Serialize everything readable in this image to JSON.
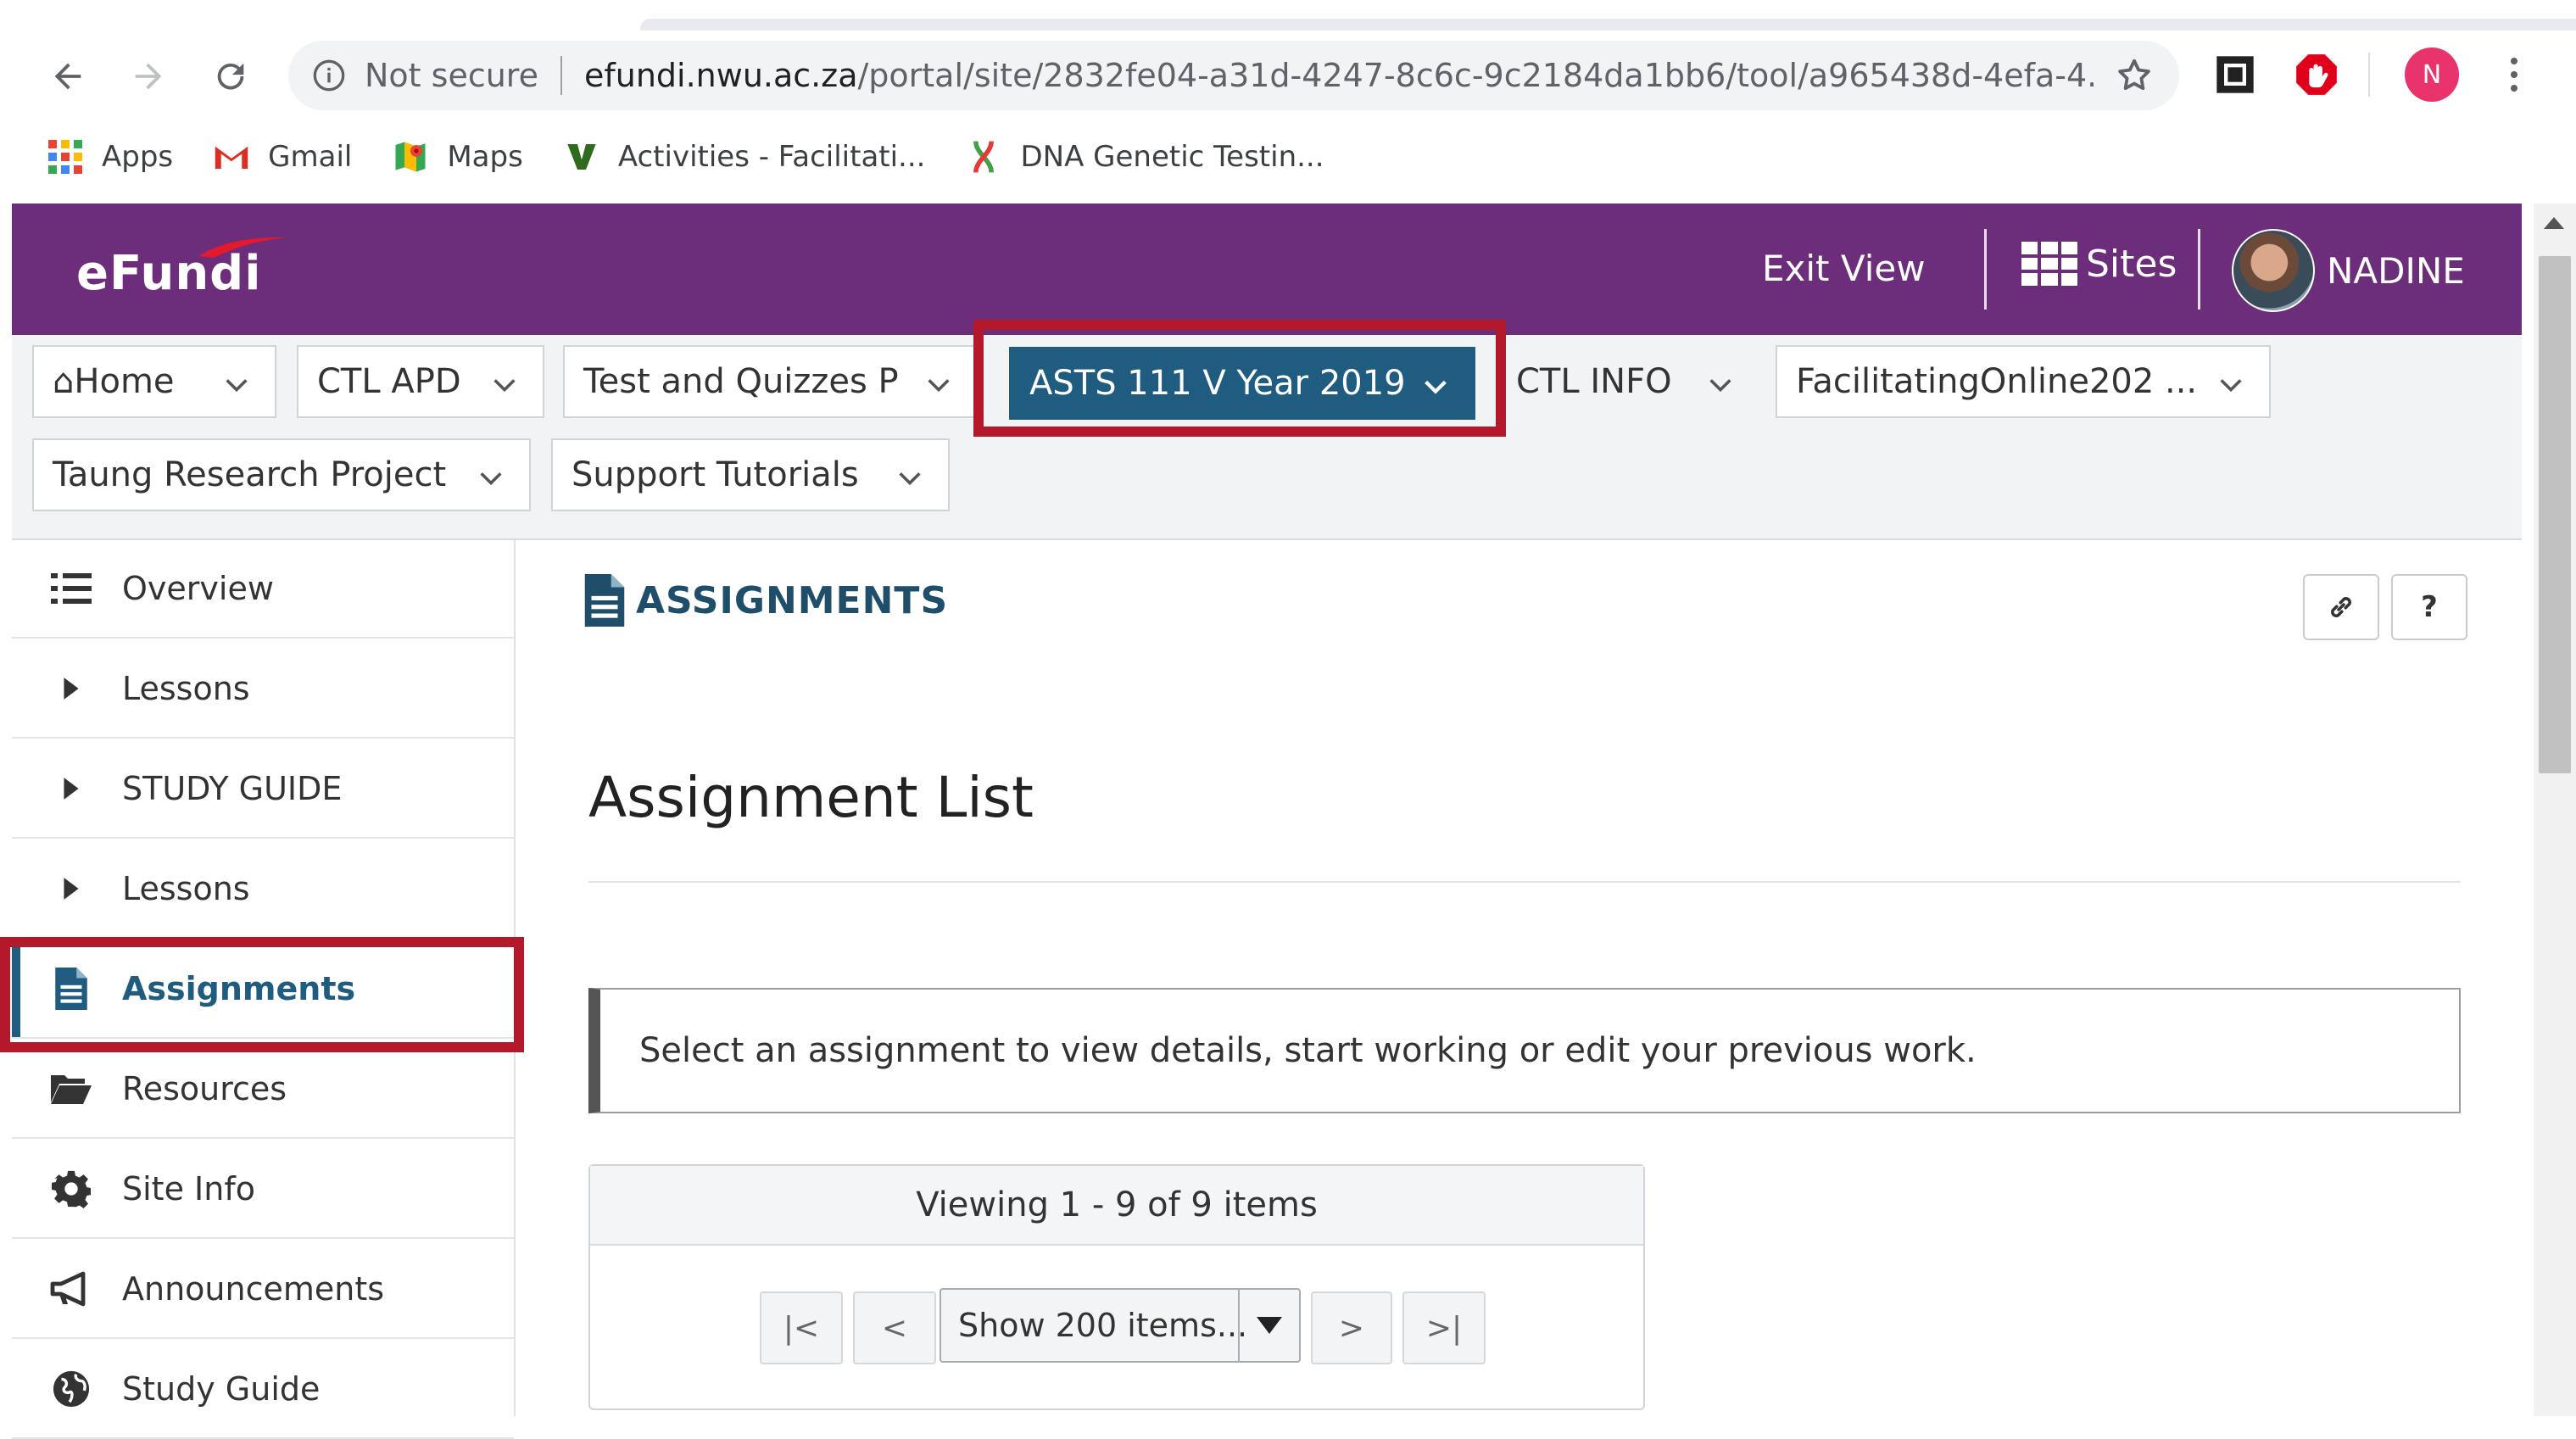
{
  "browser": {
    "security_label": "Not secure",
    "url_host": "efundi.nwu.ac.za",
    "url_path": "/portal/site/2832fe04-a31d-4247-8c6c-9c2184da1bb6/tool/a965438d-4efa-4...",
    "profile_initial": "N",
    "bookmarks": [
      {
        "label": "Apps",
        "icon": "apps-grid-icon"
      },
      {
        "label": "Gmail",
        "icon": "gmail-icon"
      },
      {
        "label": "Maps",
        "icon": "maps-icon"
      },
      {
        "label": "Activities - Facilitati...",
        "icon": "v-logo-icon"
      },
      {
        "label": "DNA Genetic Testin...",
        "icon": "dna-icon"
      }
    ]
  },
  "header": {
    "logo": "eFundi",
    "exit_view": "Exit View",
    "sites": "Sites",
    "user": "NADINE",
    "brand_color": "#6c2d7a"
  },
  "site_tabs": [
    {
      "label": "⌂Home",
      "active": false
    },
    {
      "label": "CTL APD",
      "active": false
    },
    {
      "label": "Test and Quizzes P",
      "active": false
    },
    {
      "label": "ASTS 111 V Year 2019",
      "active": true
    },
    {
      "label": "CTL INFO",
      "active": false
    },
    {
      "label": "FacilitatingOnline202 ...",
      "active": false
    },
    {
      "label": "Taung Research Project",
      "active": false
    },
    {
      "label": "Support Tutorials",
      "active": false
    }
  ],
  "sidebar": {
    "items": [
      {
        "label": "Overview",
        "icon": "list-icon"
      },
      {
        "label": "Lessons",
        "icon": "caret-right-icon"
      },
      {
        "label": "STUDY GUIDE",
        "icon": "caret-right-icon"
      },
      {
        "label": "Lessons",
        "icon": "caret-right-icon"
      },
      {
        "label": "Assignments",
        "icon": "file-icon",
        "active": true
      },
      {
        "label": "Resources",
        "icon": "folder-open-icon"
      },
      {
        "label": "Site Info",
        "icon": "gear-icon"
      },
      {
        "label": "Announcements",
        "icon": "megaphone-icon"
      },
      {
        "label": "Study Guide",
        "icon": "globe-icon"
      }
    ]
  },
  "main": {
    "tool_title": "ASSIGNMENTS",
    "link_button": "🔗",
    "help_button": "?",
    "page_title": "Assignment List",
    "instructions": "Select an assignment to view details, start working or edit your previous work.",
    "pager": {
      "viewing": "Viewing 1 - 9 of 9 items",
      "first": "|<",
      "prev": "<",
      "page_size": "Show 200 items...",
      "next": ">",
      "last": ">|"
    }
  },
  "colors": {
    "active_tab": "#1f5c80",
    "highlight": "#b4192b"
  }
}
